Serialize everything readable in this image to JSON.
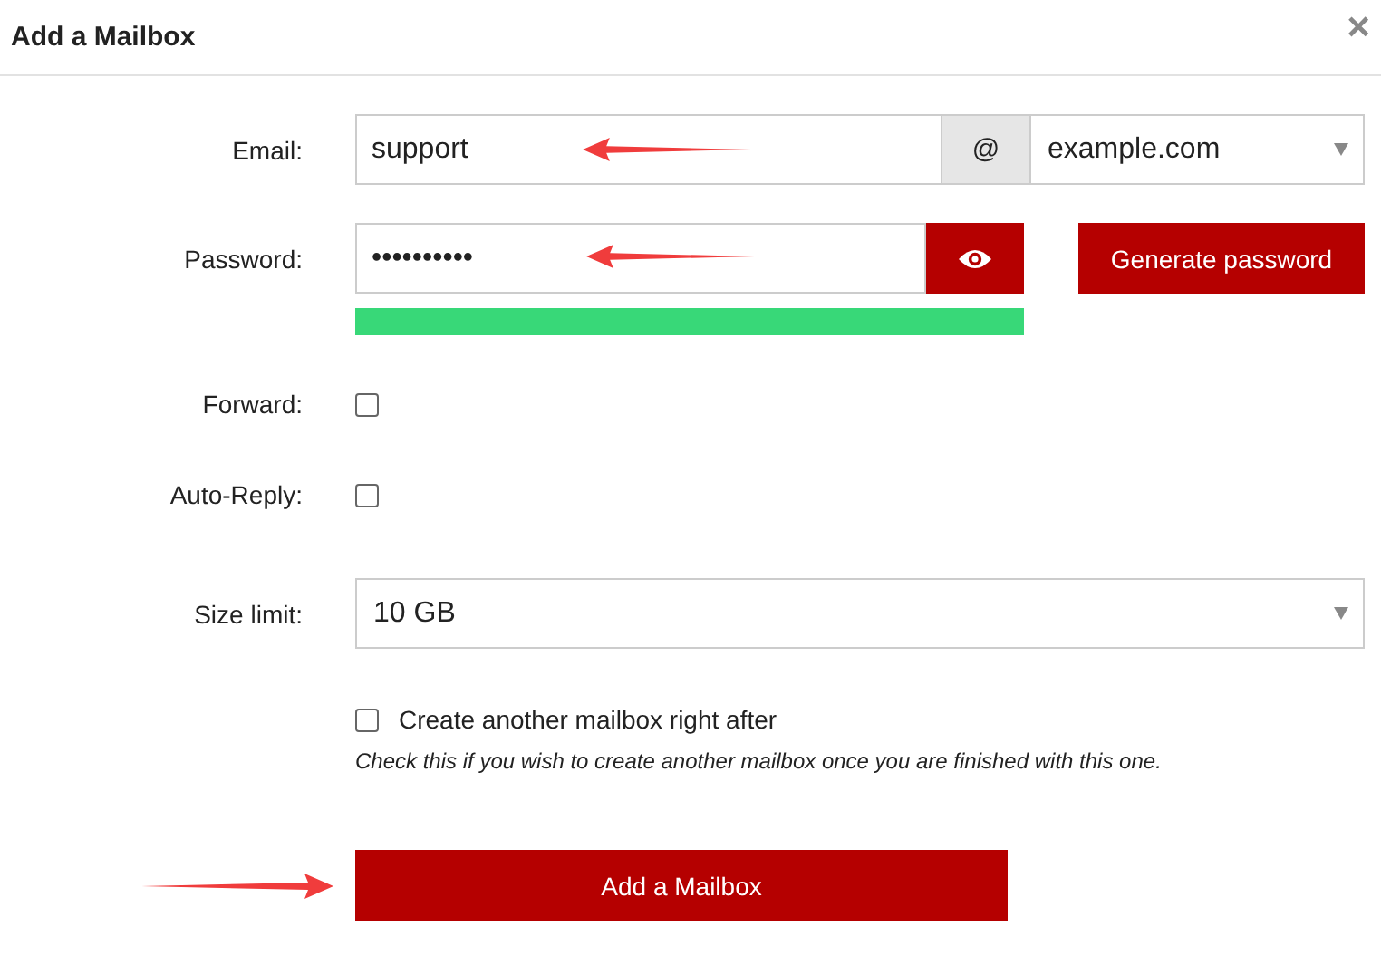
{
  "dialog": {
    "title": "Add a Mailbox",
    "close": "×"
  },
  "email": {
    "label": "Email:",
    "value": "support",
    "separator": "@",
    "domain": "example.com",
    "pointer_arrow": true
  },
  "password": {
    "label": "Password:",
    "value": "••••••••••",
    "pointer_arrow": true,
    "generate_button": "Generate password",
    "strength": {
      "level": 1
    }
  },
  "options": [
    {
      "label": "Forward:",
      "checked": false
    },
    {
      "label": "Auto-Reply:",
      "checked": false
    }
  ],
  "size_limit": {
    "label": "Size limit:",
    "value": "10 GB"
  },
  "create_another": {
    "label": "Create another mailbox right after",
    "checked": false,
    "hint": "Check this if you wish to create another mailbox once you are finished with this one."
  },
  "submit": {
    "label": "Add a Mailbox",
    "pointer_arrow": true
  }
}
